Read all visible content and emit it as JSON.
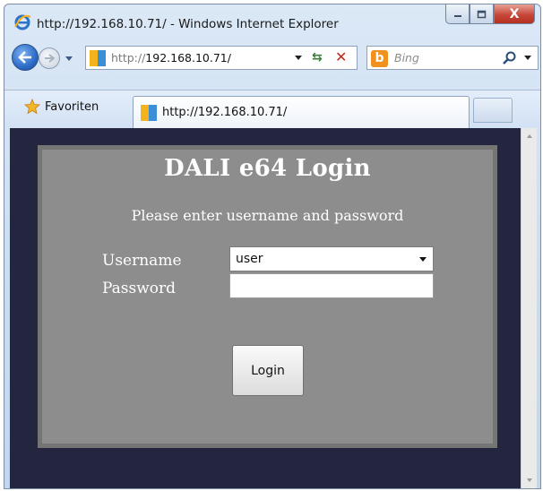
{
  "window": {
    "title": "http://192.168.10.71/ - Windows Internet Explorer",
    "icon": "ie-logo-icon"
  },
  "controls": {
    "minimize": "minimize-icon",
    "restore": "restore-icon",
    "close_label": "X"
  },
  "nav": {
    "address_prefix": "http://",
    "address_host": "192.168.10.71/",
    "search_placeholder": "Bing",
    "search_logo": "b"
  },
  "favorites": {
    "label": "Favoriten"
  },
  "tab": {
    "label": "http://192.168.10.71/"
  },
  "login": {
    "title": "DALI e64 Login",
    "subtitle": "Please enter username and password",
    "username_label": "Username",
    "password_label": "Password",
    "username_value": "user",
    "password_value": "",
    "button_label": "Login"
  },
  "colors": {
    "page_background": "#242640",
    "panel_background": "#8d8d8d",
    "panel_border": "#757575"
  }
}
